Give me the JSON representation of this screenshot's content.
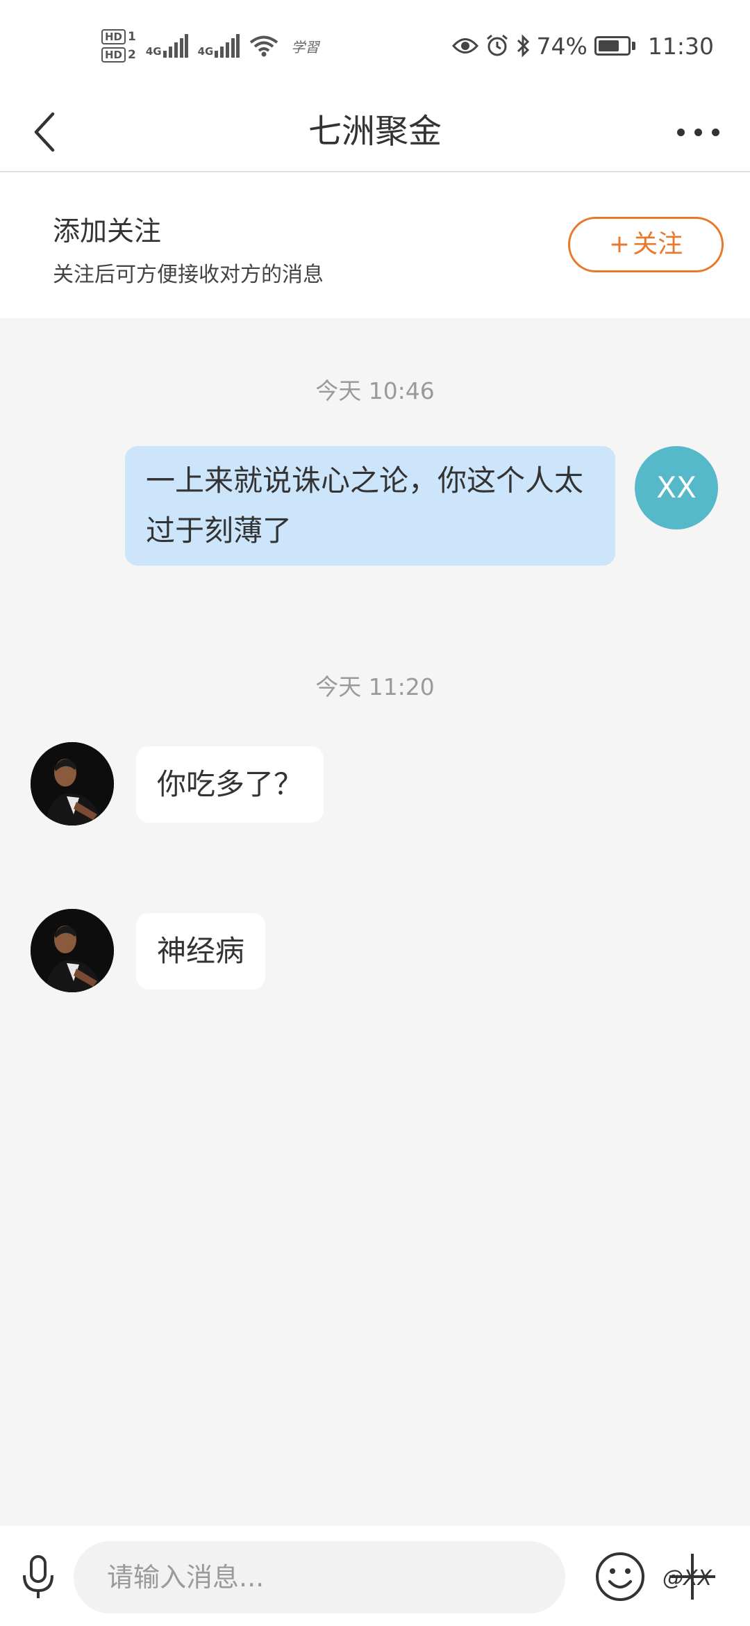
{
  "status_bar": {
    "hd1": "HD",
    "hd1_sub": "1",
    "hd2": "HD",
    "hd2_sub": "2",
    "net1": "4G",
    "net2": "4G",
    "extra": "学習",
    "battery_percent": "74%",
    "battery_level": 0.74,
    "time": "11:30"
  },
  "nav": {
    "title": "七洲聚金"
  },
  "follow": {
    "title": "添加关注",
    "subtitle": "关注后可方便接收对方的消息",
    "button_plus": "+",
    "button_label": "关注"
  },
  "chat": {
    "timestamp1": "今天 10:46",
    "outgoing_message": "一上来就说诛心之论，你这个人太过于刻薄了",
    "my_avatar_text": "XX",
    "timestamp2": "今天 11:20",
    "incoming_message1": "你吃多了？",
    "incoming_message2": "神经病"
  },
  "input": {
    "placeholder": "请输入消息..."
  },
  "watermark": "@XX",
  "colors": {
    "accent": "#e8782a",
    "bubble_out": "#cce5fb",
    "my_avatar": "#55b9c9"
  }
}
